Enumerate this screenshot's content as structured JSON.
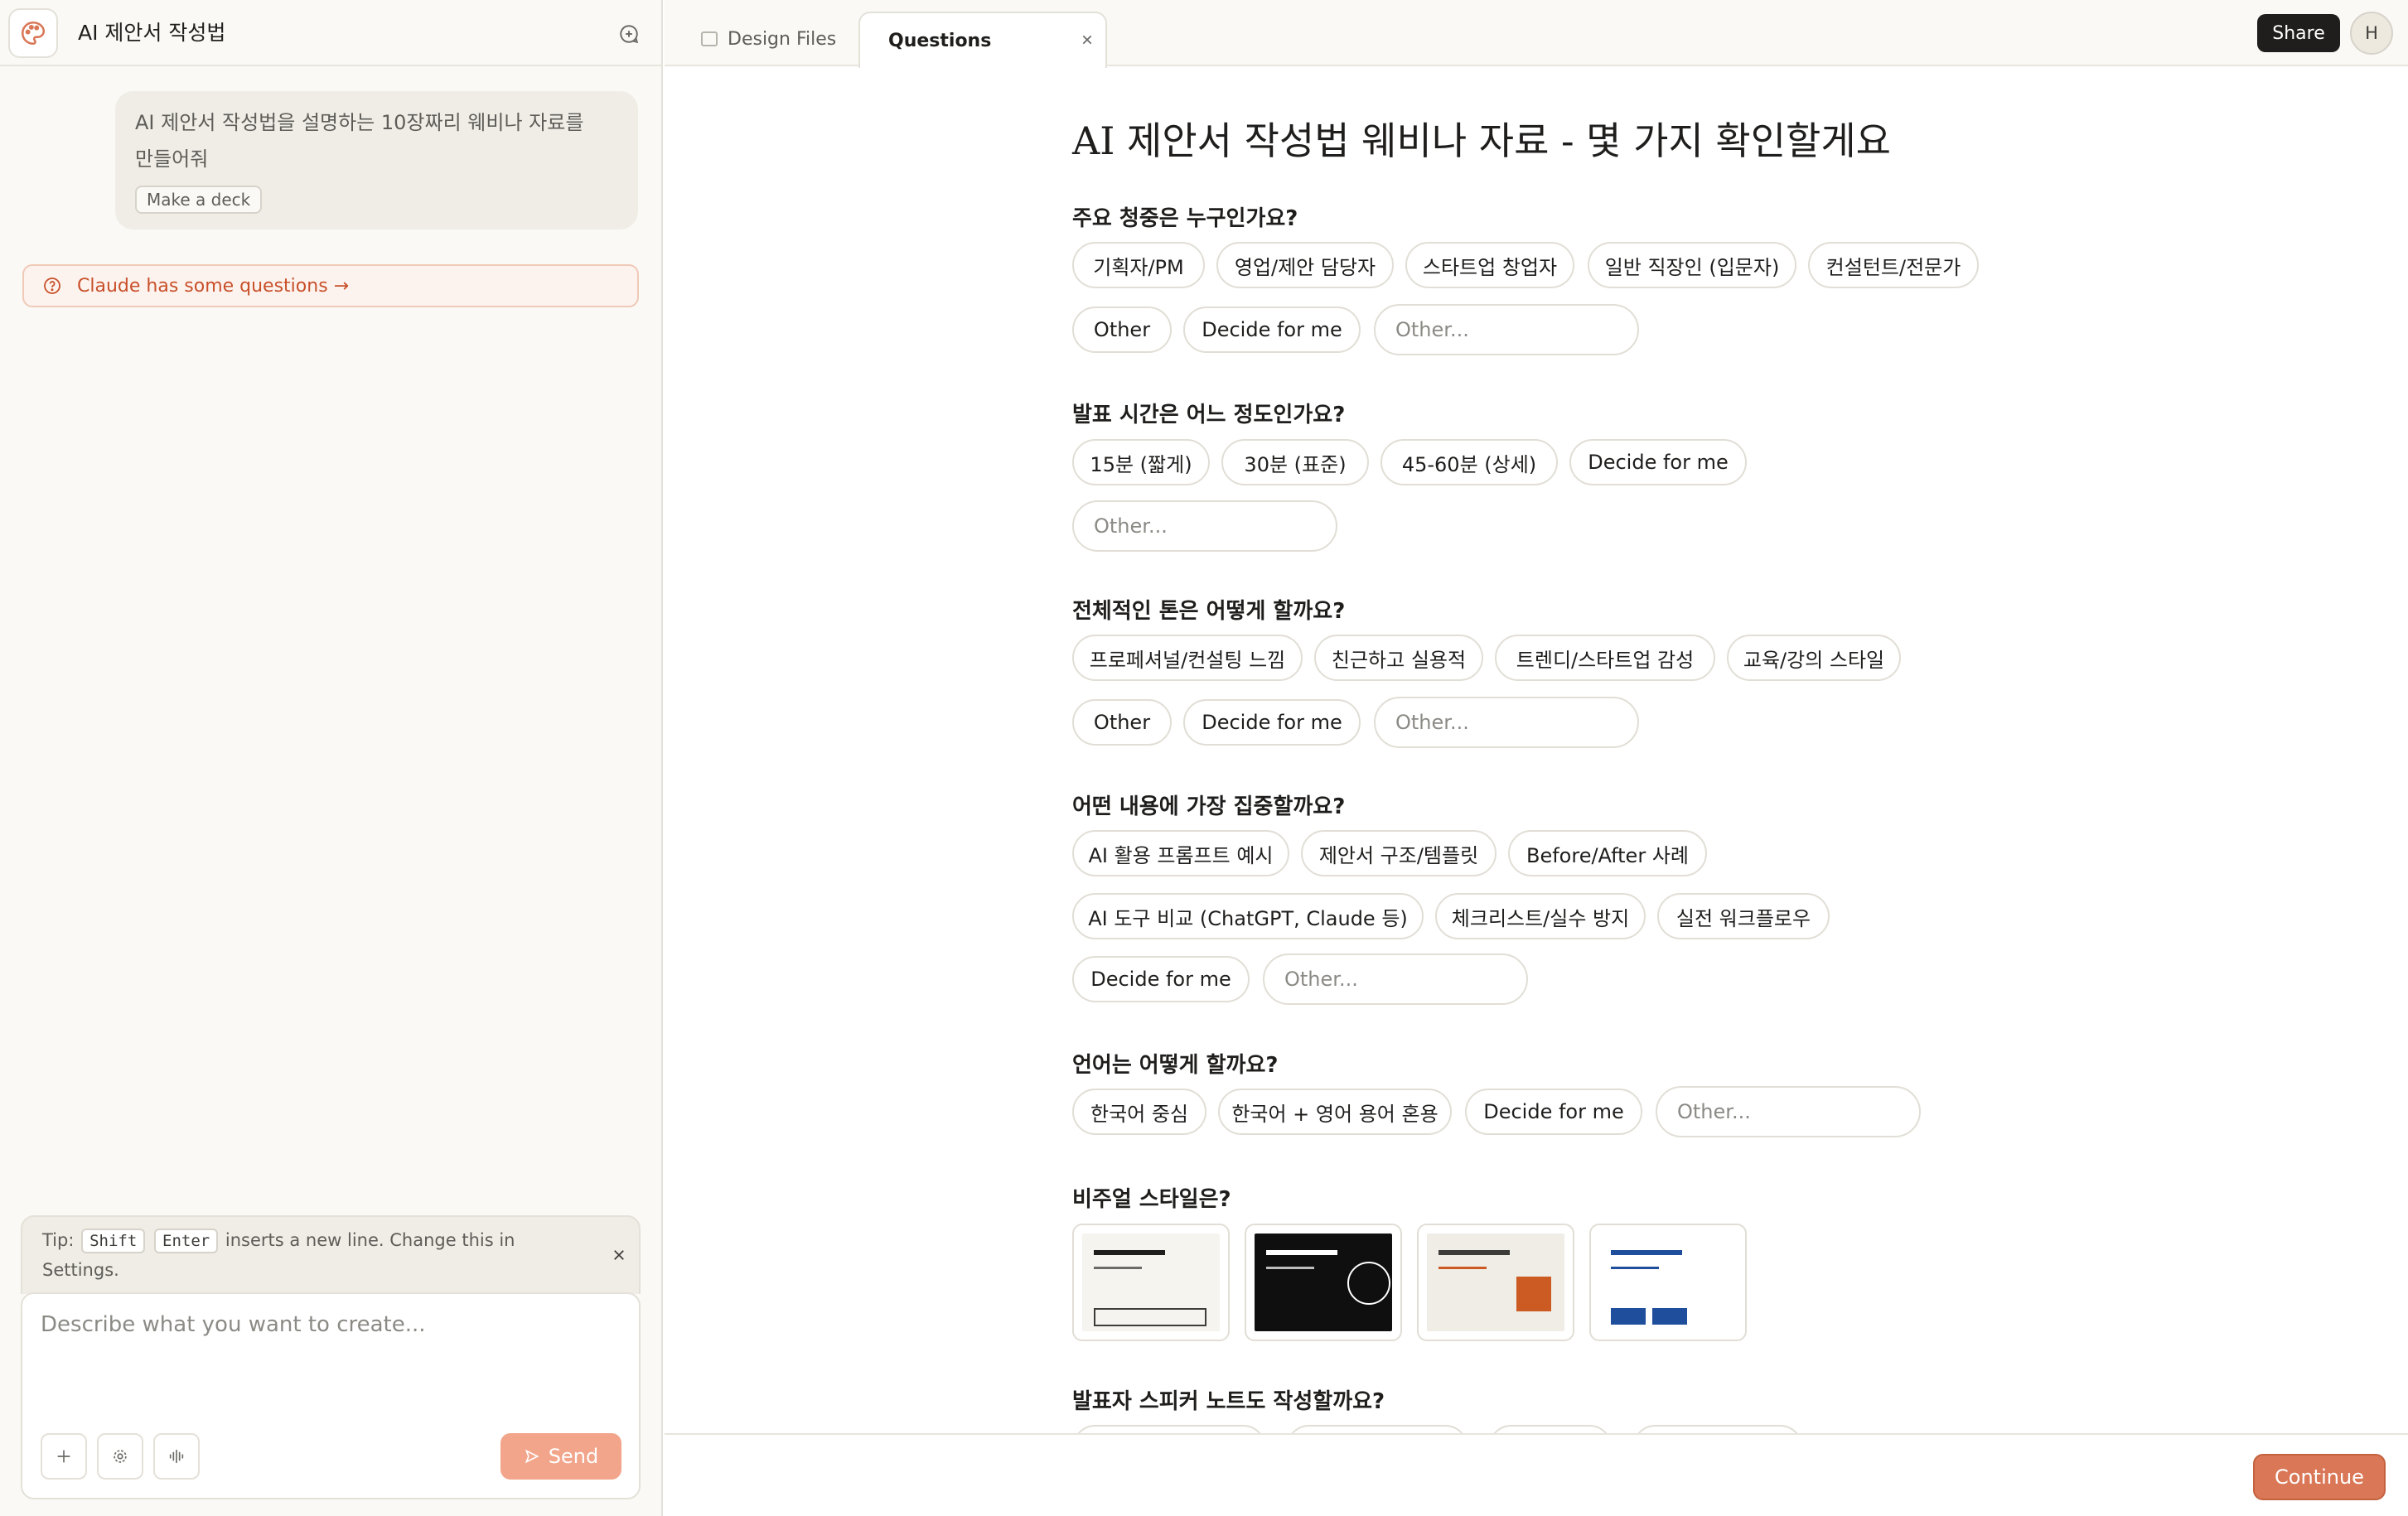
{
  "sidebar": {
    "project_title": "AI 제안서 작성법",
    "user_message": "AI 제안서 작성법을 설명하는 10장짜리 웨비나 자료를 만들어줘",
    "user_message_tag": "Make a deck",
    "questions_banner": "Claude has some questions →",
    "tip": {
      "prefix": "Tip:",
      "key1": "Shift",
      "key2": "Enter",
      "suffix": "inserts a new line. Change this in Settings."
    },
    "composer": {
      "placeholder": "Describe what you want to create...",
      "send_label": "Send"
    }
  },
  "topbar": {
    "tabs": [
      {
        "label": "Design Files"
      },
      {
        "label": "Questions"
      }
    ],
    "share_label": "Share",
    "avatar_initial": "H"
  },
  "main": {
    "title": "AI 제안서 작성법 웨비나 자료 - 몇 가지 확인할게요",
    "questions": [
      {
        "label": "주요 청중은 누구인가요?",
        "options": [
          "기획자/PM",
          "영업/제안 담당자",
          "스타트업 창업자",
          "일반 직장인 (입문자)",
          "컨설턴트/전문가",
          "Other",
          "Decide for me"
        ],
        "other_placeholder": "Other..."
      },
      {
        "label": "발표 시간은 어느 정도인가요?",
        "options": [
          "15분 (짧게)",
          "30분 (표준)",
          "45-60분 (상세)",
          "Decide for me"
        ],
        "other_placeholder": "Other..."
      },
      {
        "label": "전체적인 톤은 어떻게 할까요?",
        "options": [
          "프로페셔널/컨설팅 느낌",
          "친근하고 실용적",
          "트렌디/스타트업 감성",
          "교육/강의 스타일",
          "Other",
          "Decide for me"
        ],
        "other_placeholder": "Other..."
      },
      {
        "label": "어떤 내용에 가장 집중할까요?",
        "options": [
          "AI 활용 프롬프트 예시",
          "제안서 구조/템플릿",
          "Before/After 사례",
          "AI 도구 비교 (ChatGPT, Claude 등)",
          "체크리스트/실수 방지",
          "실전 워크플로우",
          "Decide for me"
        ],
        "other_placeholder": "Other..."
      },
      {
        "label": "언어는 어떻게 할까요?",
        "options": [
          "한국어 중심",
          "한국어 + 영어 용어 혼용",
          "Decide for me"
        ],
        "other_placeholder": "Other..."
      },
      {
        "label": "비주얼 스타일은?"
      },
      {
        "label": "발표자 스피커 노트도 작성할까요?"
      }
    ],
    "visual_styles": [
      {
        "bg": "#f6f4ef",
        "primary": "#1f1e1d",
        "accent": "#1f1e1d"
      },
      {
        "bg": "#0f0f0f",
        "primary": "#ffffff",
        "accent": "#ffffff"
      },
      {
        "bg": "#f0ede6",
        "primary": "#3d3c39",
        "accent": "#cc5a23"
      },
      {
        "bg": "#ffffff",
        "primary": "#1f4e9c",
        "accent": "#1f4e9c"
      }
    ]
  },
  "footer": {
    "continue_label": "Continue"
  },
  "colors": {
    "brand_accent": "#d97757",
    "banner_text": "#c8502a",
    "send_disabled": "#f2a58a"
  }
}
